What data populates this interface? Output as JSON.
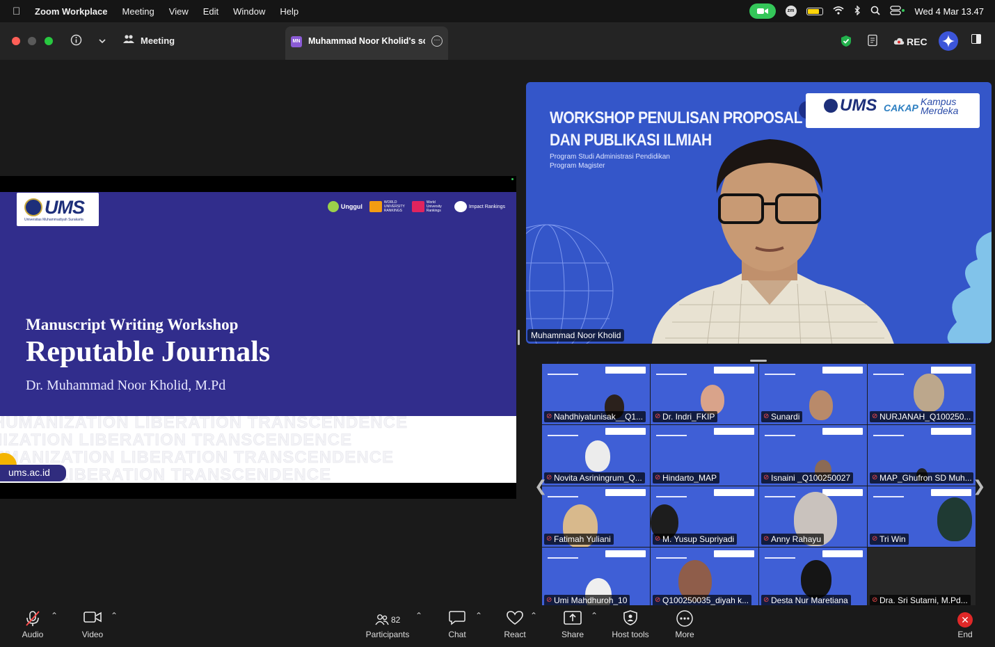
{
  "menubar": {
    "app_name": "Zoom Workplace",
    "items": [
      "Meeting",
      "View",
      "Edit",
      "Window",
      "Help"
    ],
    "clock": "Wed 4 Mar  13.47"
  },
  "titlebar": {
    "meeting_label": "Meeting",
    "tab_initials": "MN",
    "tab_title": "Muhammad Noor Kholid's screen",
    "rec_label": "REC"
  },
  "slide": {
    "logo_text": "UMS",
    "logo_sub": "Universitas Muhammadiyah Surakarta",
    "badges": [
      "Unggul",
      "WORLD UNIVERSITY RANKINGS",
      "World University Rankings",
      "Impact Rankings"
    ],
    "line1": "Manuscript Writing Workshop",
    "line2": "Reputable Journals",
    "line3": "Dr. Muhammad Noor Kholid, M.Pd",
    "pattern_text": "HUMANIZATION LIBERATION TRANSCENDENCE",
    "url": "ums.ac.id"
  },
  "speaker": {
    "title1": "WORKSHOP PENULISAN PROPOSAL RISET",
    "title2": "DAN PUBLIKASI ILMIAH",
    "subtitle1": "Program Studi Administrasi Pendidikan",
    "subtitle2": "Program Magister",
    "logos": [
      "UMS",
      "CAKAP",
      "Kampus Merdeka"
    ],
    "name": "Muhammad Noor Kholid"
  },
  "gallery": {
    "participants": [
      "Nahdhiyatunisak__Q1...",
      "Dr. Indri_FKIP",
      "Sunardi",
      "NURJANAH_Q100250...",
      "Novita Asriningrum_Q...",
      "Hindarto_MAP",
      "Isnaini _Q100250027",
      "MAP_Ghufron SD Muh...",
      "Fatimah Yuliani",
      "M. Yusup Supriyadi",
      "Anny Rahayu",
      "Tri Win",
      "Umi Mahdhuroh_10",
      "Q100250035_diyah k...",
      "Desta Nur Maretiana",
      "Dra. Sri Sutarni, M.Pd..."
    ]
  },
  "toolbar": {
    "audio": "Audio",
    "video": "Video",
    "participants": "Participants",
    "participants_count": "82",
    "chat": "Chat",
    "react": "React",
    "share": "Share",
    "host_tools": "Host tools",
    "more": "More",
    "end": "End"
  },
  "colors": {
    "slide_bg": "#312d8c",
    "speaker_bg": "#3456c9",
    "end_red": "#e02828",
    "camera_green": "#34c759"
  }
}
